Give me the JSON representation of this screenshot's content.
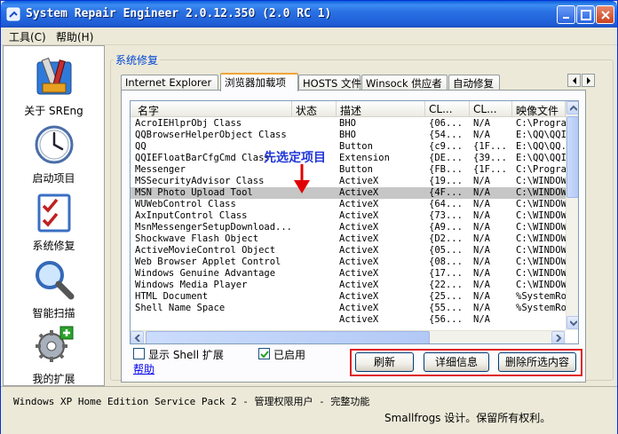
{
  "window": {
    "title": "System Repair Engineer 2.0.12.350 (2.0 RC 1)"
  },
  "menu": [
    "工具(C)",
    "帮助(H)"
  ],
  "sidebar": {
    "items": [
      {
        "label": "关于 SREng",
        "icon": "tools-icon"
      },
      {
        "label": "启动项目",
        "icon": "clock-icon"
      },
      {
        "label": "系统修复",
        "icon": "checklist-icon"
      },
      {
        "label": "智能扫描",
        "icon": "magnifier-icon"
      },
      {
        "label": "我的扩展",
        "icon": "gear-plus-icon"
      }
    ]
  },
  "main": {
    "group_title": "系统修复",
    "tabs": [
      {
        "label": "Internet Explorer",
        "active": false
      },
      {
        "label": "浏览器加载项",
        "active": true
      },
      {
        "label": "HOSTS 文件",
        "active": false
      },
      {
        "label": "Winsock 供应者",
        "active": false
      },
      {
        "label": "自动修复",
        "active": false
      }
    ],
    "columns": [
      "名字",
      "状态",
      "描述",
      "CL...",
      "CL...",
      "映像文件"
    ],
    "rows": [
      [
        "AcroIEHlprObj Class",
        "",
        "BHO",
        "{06...",
        "N/A",
        "C:\\Progra"
      ],
      [
        "QQBrowserHelperObject Class",
        "",
        "BHO",
        "{54...",
        "N/A",
        "E:\\QQ\\QQI"
      ],
      [
        "QQ",
        "",
        "Button",
        "{c9...",
        "{1F...",
        "E:\\QQ\\QQ."
      ],
      [
        "QQIEFloatBarCfgCmd Class",
        "",
        "Extension",
        "{DE...",
        "{39...",
        "E:\\QQ\\QQI"
      ],
      [
        "Messenger",
        "",
        "Button",
        "{FB...",
        "{1F...",
        "C:\\Progra"
      ],
      [
        "MSSecurityAdvisor Class",
        "",
        "ActiveX",
        "{19...",
        "N/A",
        "C:\\WINDOW"
      ],
      [
        "MSN Photo Upload Tool",
        "",
        "ActiveX",
        "{4F...",
        "N/A",
        "C:\\WINDOW"
      ],
      [
        "WUWebControl Class",
        "",
        "ActiveX",
        "{64...",
        "N/A",
        "C:\\WINDOW"
      ],
      [
        "AxInputControl Class",
        "",
        "ActiveX",
        "{73...",
        "N/A",
        "C:\\WINDOW"
      ],
      [
        "MsnMessengerSetupDownload...",
        "",
        "ActiveX",
        "{A9...",
        "N/A",
        "C:\\WINDOW"
      ],
      [
        "Shockwave Flash Object",
        "",
        "ActiveX",
        "{D2...",
        "N/A",
        "C:\\WINDOW"
      ],
      [
        "ActiveMovieControl Object",
        "",
        "ActiveX",
        "{05...",
        "N/A",
        "C:\\WINDOW"
      ],
      [
        "Web Browser Applet Control",
        "",
        "ActiveX",
        "{08...",
        "N/A",
        "C:\\WINDOW"
      ],
      [
        "Windows Genuine Advantage",
        "",
        "ActiveX",
        "{17...",
        "N/A",
        "C:\\WINDOW"
      ],
      [
        "Windows Media Player",
        "",
        "ActiveX",
        "{22...",
        "N/A",
        "C:\\WINDOW"
      ],
      [
        "HTML Document",
        "",
        "ActiveX",
        "{25...",
        "N/A",
        "%SystemRo"
      ],
      [
        "Shell Name Space",
        "",
        "ActiveX",
        "{55...",
        "N/A",
        "%SystemRo"
      ],
      [
        "",
        "",
        "ActiveX",
        "{56...",
        "N/A",
        ""
      ]
    ],
    "selected_row": 6,
    "annotation": "先选定项目",
    "checkboxes": [
      {
        "label": "显示 Shell 扩展",
        "checked": false
      },
      {
        "label": "已启用",
        "checked": true
      }
    ],
    "help_link": "帮助",
    "buttons": {
      "refresh": "刷新",
      "details": "详细信息",
      "delete": "删除所选内容"
    }
  },
  "status": {
    "line1": "Windows XP Home Edition Service Pack 2 - 管理权限用户 - 完整功能",
    "line2": "Smallfrogs 设计。保留所有权利。"
  },
  "colors": {
    "title_bar": "#2a72e4",
    "accent_link": "#0046d5",
    "annotation": "#2036d8",
    "highlight_box": "#e02020",
    "selected_row": "#c6c6c6"
  }
}
